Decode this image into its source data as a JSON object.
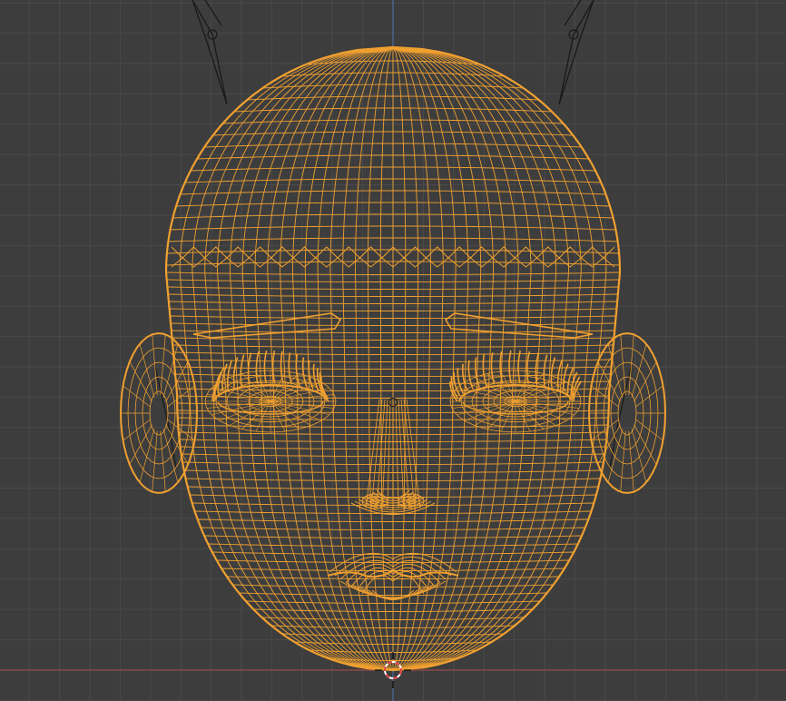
{
  "app": {
    "view": "3d-viewport",
    "shading_mode": "wireframe",
    "view_orientation": "front"
  },
  "colors": {
    "background": "#3d3d3d",
    "grid_line": "#4a4a4a",
    "grid_line_major": "#505050",
    "axis_x": "#b04a4a",
    "axis_z": "#4a78b4",
    "selected_wire": "#f0a030",
    "bone_wire": "#1a1a1a",
    "cursor_ring_red": "#e04040",
    "cursor_ring_white": "#ffffff"
  },
  "scene": {
    "mesh_selected": true,
    "armature_visible": true,
    "origin_marker_visible": true,
    "cursor_3d_visible": true
  },
  "icons": {
    "cursor": "3d-cursor-icon",
    "origin": "object-origin-icon"
  }
}
